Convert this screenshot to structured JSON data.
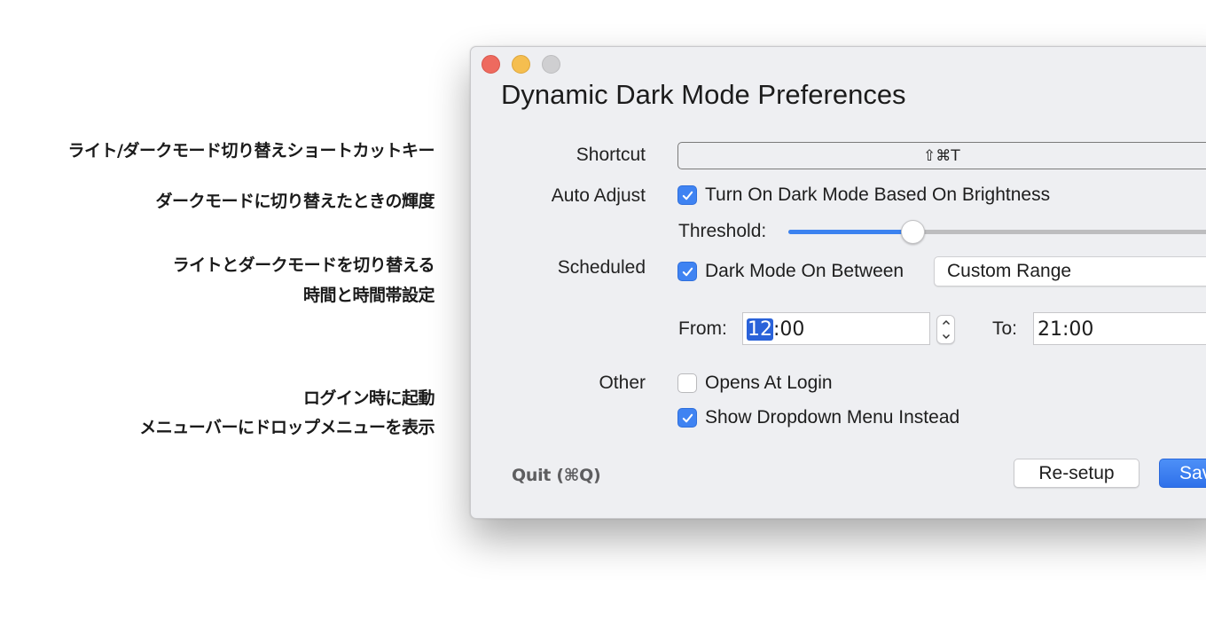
{
  "annotations": [
    "ライト/ダークモード切り替えショートカットキー",
    "ダークモードに切り替えたときの輝度",
    "ライトとダークモードを切り替える",
    "時間と時間帯設定",
    "ログイン時に起動",
    "メニューバーにドロップメニューを表示"
  ],
  "window": {
    "title": "Dynamic Dark Mode Preferences",
    "traffic_lights": {
      "close": "#ee6a5f",
      "minimize": "#f5be4f",
      "zoom": "#cfcfd1"
    }
  },
  "shortcut": {
    "label": "Shortcut",
    "value": "⇧⌘T"
  },
  "auto_adjust": {
    "label": "Auto Adjust",
    "checkbox_label": "Turn On Dark Mode Based On Brightness",
    "checked": true,
    "threshold_label": "Threshold:",
    "threshold_value_fraction": 0.27
  },
  "scheduled": {
    "label": "Scheduled",
    "checkbox_label": "Dark Mode On Between",
    "checked": true,
    "range_select": "Custom Range",
    "from_label": "From:",
    "from_hour": "12",
    "from_rest": ":00",
    "to_label": "To:",
    "to_value": "21:00"
  },
  "other": {
    "label": "Other",
    "opens_at_login_label": "Opens At Login",
    "opens_at_login_checked": false,
    "dropdown_menu_label": "Show Dropdown Menu Instead",
    "dropdown_menu_checked": true
  },
  "footer": {
    "quit_label": "Quit (⌘Q)",
    "resetup_label": "Re-setup",
    "save_label": "Save"
  },
  "colors": {
    "accent": "#3f83f2",
    "window_bg": "#eeeff2"
  }
}
